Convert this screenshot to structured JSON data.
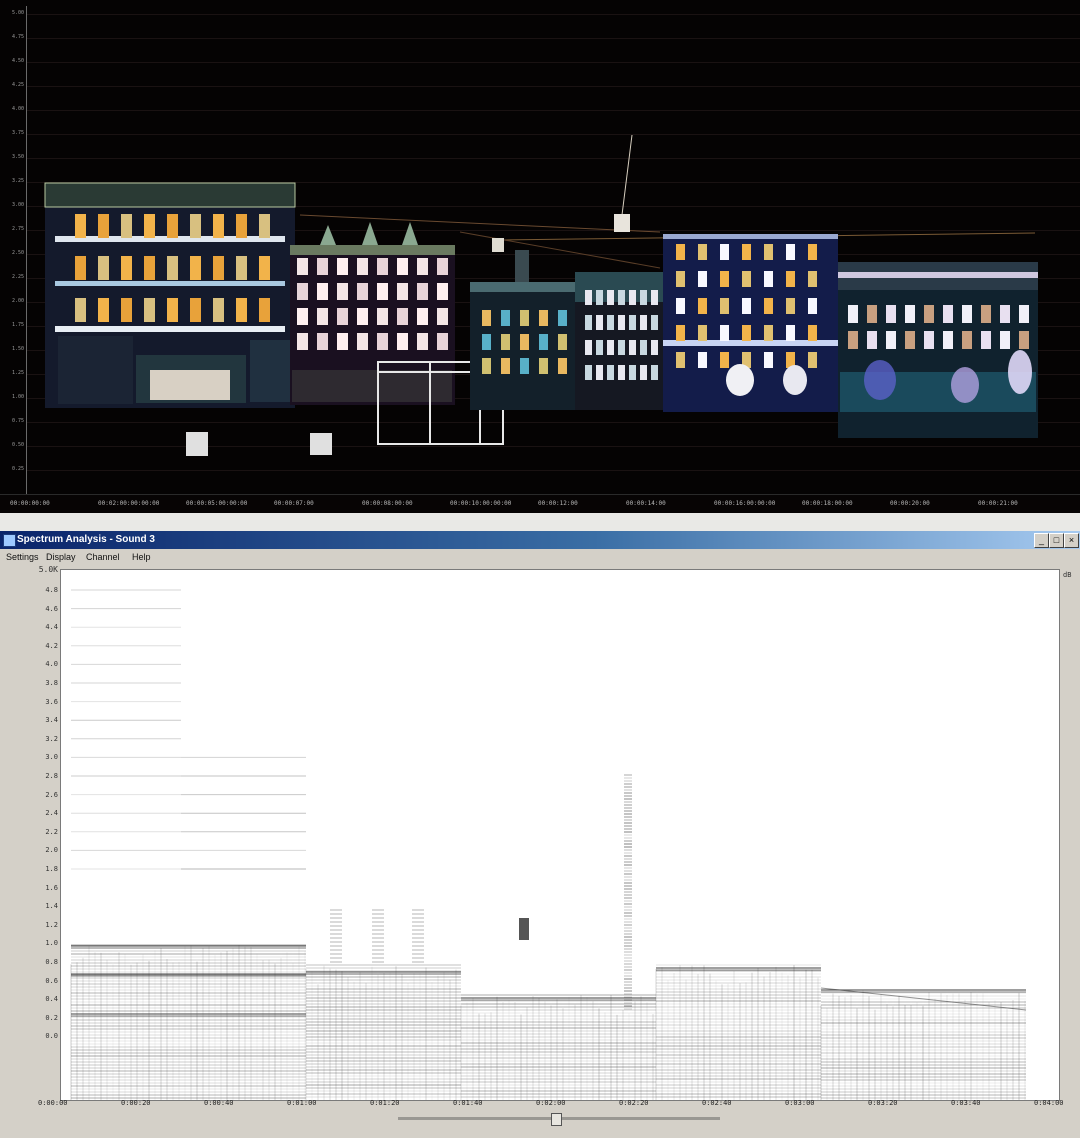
{
  "top_panel": {
    "y_axis_labels": [
      "5.00",
      "4.75",
      "4.50",
      "4.25",
      "4.00",
      "3.75",
      "3.50",
      "3.25",
      "3.00",
      "2.75",
      "2.50",
      "2.25",
      "2.00",
      "1.75",
      "1.50",
      "1.25",
      "1.00",
      "0.75",
      "0.50",
      "0.25"
    ],
    "x_axis_labels": [
      "00:00:00:00",
      "00:02:00:00:00:00",
      "00:00:05:00:00:00",
      "00:00:07:00",
      "00:00:08:00:00",
      "00:00:10:00:00:00",
      "00:00:12:00",
      "00:00:14:00",
      "00:00:16:00:00:00",
      "00:00:18:00:00",
      "00:00:20:00",
      "00:00:21:00"
    ],
    "colors": {
      "background": "#050303",
      "window_light": "#f2b34a",
      "facade": "#1a1e3a",
      "accent": "#5ab0c8"
    }
  },
  "window": {
    "title": "Spectrum Analysis - Sound 3",
    "menu": [
      "Settings",
      "Display",
      "Channel",
      "Help"
    ],
    "buttons": {
      "minimize": "_",
      "maximize": "□",
      "close": "×"
    },
    "freq_top_label": "5.0K",
    "freq_labels": [
      "4.8",
      "4.6",
      "4.4",
      "4.2",
      "4.0",
      "3.8",
      "3.6",
      "3.4",
      "3.2",
      "3.0",
      "2.8",
      "2.6",
      "2.4",
      "2.2",
      "2.0",
      "1.8",
      "1.6",
      "1.4",
      "1.2",
      "1.0",
      "0.8",
      "0.6",
      "0.4",
      "0.2",
      "0.0"
    ],
    "time_labels": [
      "0:00:00",
      "0:00:20",
      "0:00:40",
      "0:01:00",
      "0:01:20",
      "0:01:40",
      "0:02:00",
      "0:02:20",
      "0:02:40",
      "0:03:00",
      "0:03:20",
      "0:03:40",
      "0:04:00"
    ],
    "right_label": "dB",
    "scroll_position": 0.49,
    "colors": {
      "titlebar_start": "#0a246a",
      "titlebar_end": "#a6caf0",
      "chrome": "#d4d0c8",
      "plot_bg": "#ffffff",
      "ink": "#2a2a2a"
    }
  }
}
